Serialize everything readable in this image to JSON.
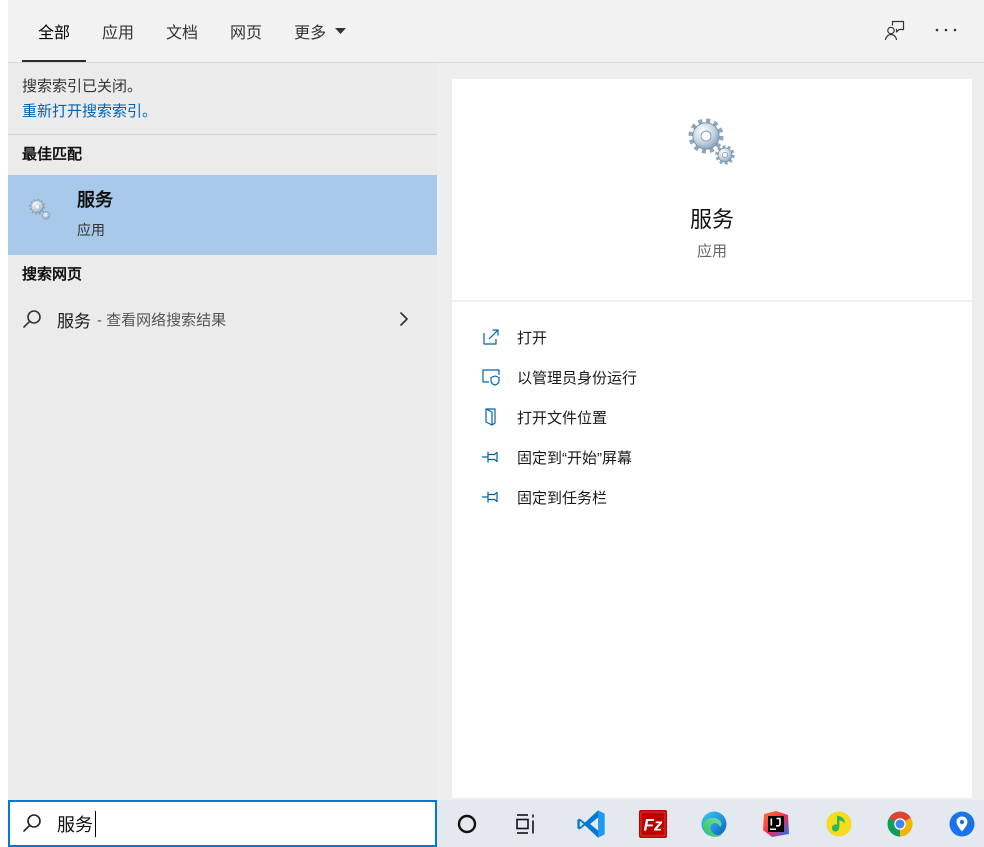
{
  "tabs": {
    "items": [
      {
        "label": "全部"
      },
      {
        "label": "应用"
      },
      {
        "label": "文档"
      },
      {
        "label": "网页"
      },
      {
        "label": "更多"
      }
    ],
    "selected_index": 0
  },
  "header": {
    "feedback_icon": "feedback-icon",
    "more_icon": "more-options-icon"
  },
  "index_notice": {
    "message": "搜索索引已关闭。",
    "link": "重新打开搜索索引。"
  },
  "best_match": {
    "header": "最佳匹配",
    "title": "服务",
    "subtitle": "应用",
    "icon": "services-gear-icon"
  },
  "web_search": {
    "header": "搜索网页",
    "query": "服务",
    "suffix": "- 查看网络搜索结果",
    "icon": "search-icon"
  },
  "preview": {
    "title": "服务",
    "subtitle": "应用",
    "icon": "services-gear-icon",
    "actions": [
      {
        "label": "打开",
        "icon": "open-icon"
      },
      {
        "label": "以管理员身份运行",
        "icon": "run-as-admin-icon"
      },
      {
        "label": "打开文件位置",
        "icon": "file-location-icon"
      },
      {
        "label": "固定到“开始”屏幕",
        "icon": "pin-icon"
      },
      {
        "label": "固定到任务栏",
        "icon": "pin-icon"
      }
    ]
  },
  "search_box": {
    "value": "服务",
    "icon": "search-icon"
  },
  "taskbar": {
    "icons": [
      "cortana-icon",
      "task-view-icon",
      "vscode-icon",
      "filezilla-icon",
      "edge-icon",
      "jetbrains-ide-icon",
      "qq-music-icon",
      "chrome-icon",
      "maps-pin-icon"
    ],
    "filezilla_logo_text": "Fz"
  },
  "colors": {
    "accent": "#0078d7",
    "link": "#0063b1",
    "selected_row": "#a8c9ea",
    "panel": "#ebebeb"
  }
}
